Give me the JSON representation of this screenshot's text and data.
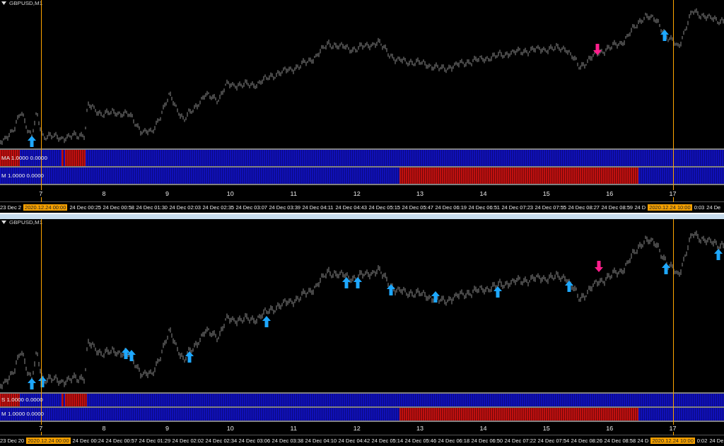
{
  "panels": [
    {
      "symbol": "GBPUSD,M1",
      "indicators": [
        {
          "label": "MA 1.0000 0.0000"
        },
        {
          "label": "M 1.0000 0.0000"
        }
      ],
      "scale": [
        "7",
        "8",
        "9",
        "10",
        "11",
        "12",
        "13",
        "14",
        "15",
        "16",
        "17"
      ],
      "time_axis": [
        {
          "kind": "tick",
          "text": "23 Dec 2"
        },
        {
          "kind": "cursor",
          "text": "2020.12.24 00:00"
        },
        {
          "kind": "tick",
          "text": "24 Dec 00:25"
        },
        {
          "kind": "tick",
          "text": "24 Dec 00:58"
        },
        {
          "kind": "tick",
          "text": "24 Dec 01:30"
        },
        {
          "kind": "tick",
          "text": "24 Dec 02:03"
        },
        {
          "kind": "tick",
          "text": "24 Dec 02:35"
        },
        {
          "kind": "tick",
          "text": "24 Dec 03:07"
        },
        {
          "kind": "tick",
          "text": "24 Dec 03:39"
        },
        {
          "kind": "tick",
          "text": "24 Dec 04:11"
        },
        {
          "kind": "tick",
          "text": "24 Dec 04:43"
        },
        {
          "kind": "tick",
          "text": "24 Dec 05:15"
        },
        {
          "kind": "tick",
          "text": "24 Dec 05:47"
        },
        {
          "kind": "tick",
          "text": "24 Dec 06:19"
        },
        {
          "kind": "tick",
          "text": "24 Dec 06:51"
        },
        {
          "kind": "tick",
          "text": "24 Dec 07:23"
        },
        {
          "kind": "tick",
          "text": "24 Dec 07:55"
        },
        {
          "kind": "tick",
          "text": "24 Dec 08:27"
        },
        {
          "kind": "tick",
          "text": "24 Dec 08:59"
        },
        {
          "kind": "tick",
          "text": "24 D"
        },
        {
          "kind": "cursor",
          "text": "2020.12.24 10:00"
        },
        {
          "kind": "tick",
          "text": "0:03"
        },
        {
          "kind": "tick",
          "text": "24 De"
        }
      ]
    },
    {
      "symbol": "GBPUSD,M1",
      "indicators": [
        {
          "label": "S 1.0000 0.0000"
        },
        {
          "label": "M 1.0000 0.0000"
        }
      ],
      "scale": [
        "7",
        "8",
        "9",
        "10",
        "11",
        "12",
        "13",
        "14",
        "15",
        "16",
        "17"
      ],
      "time_axis": [
        {
          "kind": "tick",
          "text": "23 Dec 20"
        },
        {
          "kind": "cursor",
          "text": "2020.12.24 00:00"
        },
        {
          "kind": "tick",
          "text": "24 Dec 00:24"
        },
        {
          "kind": "tick",
          "text": "24 Dec 00:57"
        },
        {
          "kind": "tick",
          "text": "24 Dec 01:29"
        },
        {
          "kind": "tick",
          "text": "24 Dec 02:02"
        },
        {
          "kind": "tick",
          "text": "24 Dec 02:34"
        },
        {
          "kind": "tick",
          "text": "24 Dec 03:06"
        },
        {
          "kind": "tick",
          "text": "24 Dec 03:38"
        },
        {
          "kind": "tick",
          "text": "24 Dec 04:10"
        },
        {
          "kind": "tick",
          "text": "24 Dec 04:42"
        },
        {
          "kind": "tick",
          "text": "24 Dec 05:14"
        },
        {
          "kind": "tick",
          "text": "24 Dec 05:46"
        },
        {
          "kind": "tick",
          "text": "24 Dec 06:18"
        },
        {
          "kind": "tick",
          "text": "24 Dec 06:50"
        },
        {
          "kind": "tick",
          "text": "24 Dec 07:22"
        },
        {
          "kind": "tick",
          "text": "24 Dec 07:54"
        },
        {
          "kind": "tick",
          "text": "24 Dec 08:26"
        },
        {
          "kind": "tick",
          "text": "24 Dec 08:58"
        },
        {
          "kind": "tick",
          "text": "24 D"
        },
        {
          "kind": "cursor",
          "text": "2020.12.24 10:00"
        },
        {
          "kind": "tick",
          "text": "0:02"
        },
        {
          "kind": "tick",
          "text": "24 De"
        }
      ]
    }
  ]
}
